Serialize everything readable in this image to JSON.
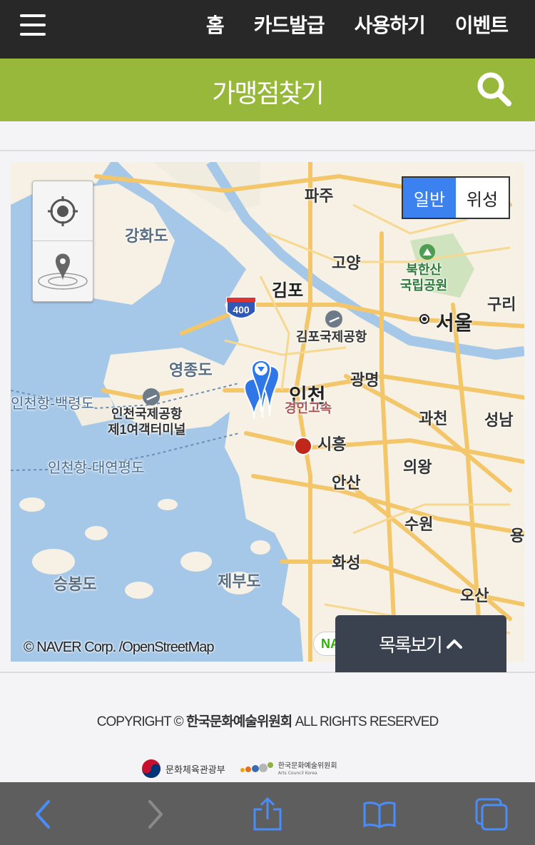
{
  "nav": {
    "links": [
      "홈",
      "카드발급",
      "사용하기",
      "이벤트"
    ]
  },
  "header": {
    "title": "가맹점찾기"
  },
  "map": {
    "type_toggle": {
      "normal": "일반",
      "satellite": "위성"
    },
    "labels": {
      "paju": "파주",
      "ganghwado": "강화도",
      "goyang": "고양",
      "bukhansan": "북한산\n국립공원",
      "gimpo": "김포",
      "guri": "구리",
      "seoul": "서울",
      "gimpo_airport": "김포국제공항",
      "route_400": "400",
      "yeongjongdo": "영종도",
      "gwangmyeong": "광명",
      "incheon": "인천",
      "incheon_port_baengnyeong": "인천항-백령도",
      "incheon_airport": "인천국제공항\n제1여객터미널",
      "gyeongin_expressway": "경인고속",
      "gwacheon": "과천",
      "seongnam": "성남",
      "siheung": "시흥",
      "uiwang": "의왕",
      "incheon_port_daeyeonpyeong": "인천항-대연평도",
      "ansan": "안산",
      "suwon": "수원",
      "yong": "용",
      "hwaseong": "화성",
      "seungbongdo": "승봉도",
      "jebudo": "제부도",
      "osan": "오산"
    },
    "attribution": "© NAVER Corp. /OpenStreetMap",
    "naver_logo": "NA"
  },
  "list_button": {
    "label": "목록보기"
  },
  "footer": {
    "copyright_prefix": "COPYRIGHT © ",
    "copyright_org": "한국문화예술위원회",
    "copyright_suffix": " ALL RIGHTS RESERVED",
    "logo1": "문화체육관광부",
    "logo2": "한국문화예술위원회",
    "logo2_sub": "Arts Council Korea"
  },
  "colors": {
    "topnav_bg": "#282828",
    "titlebar_bg": "#98b83c",
    "map_toggle_active": "#3b82f0",
    "list_button_bg": "#3a4250",
    "safari_bar": "#5e5e5e",
    "safari_icon": "#4a8df8"
  }
}
